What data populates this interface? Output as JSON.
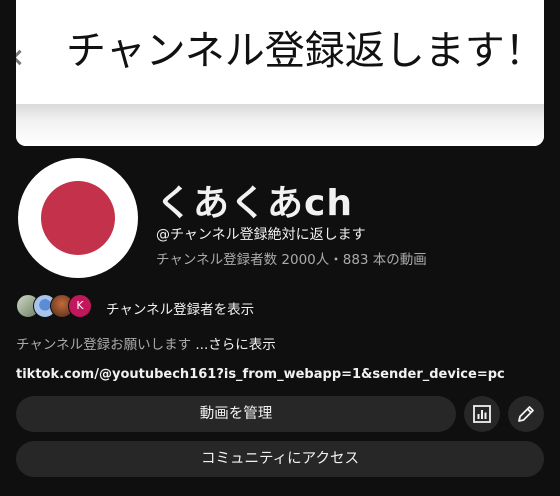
{
  "banner": {
    "text": "チャンネル登録返します！"
  },
  "channel": {
    "name": "くあくあch",
    "handle": "@チャンネル登録絶対に返します",
    "stats": "チャンネル登録者数 2000人・883 本の動画"
  },
  "subscribers": {
    "avatar_letter": "K",
    "label": "チャンネル登録者を表示"
  },
  "description": {
    "text": "チャンネル登録お願いします ",
    "more": "...さらに表示"
  },
  "link": "tiktok.com/@youtubech161?is_from_webapp=1&sender_device=pc",
  "buttons": {
    "manage": "動画を管理",
    "community": "コミュニティにアクセス"
  },
  "icons": {
    "analytics": "analytics-icon",
    "edit": "pencil-icon"
  },
  "colors": {
    "background": "#0f0f0f",
    "button": "#272727",
    "avatar_dot": "#c4314a",
    "muted_text": "#aaaaaa"
  }
}
